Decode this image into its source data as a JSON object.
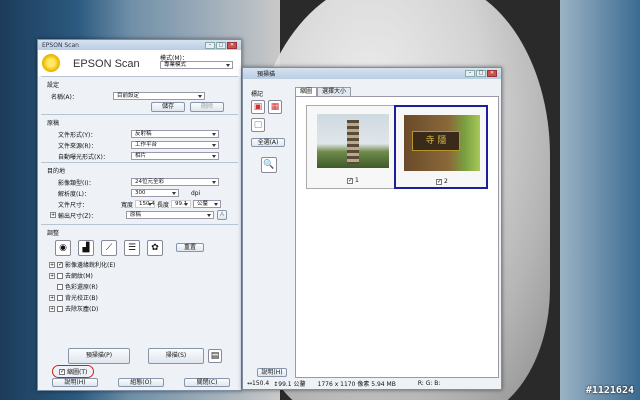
{
  "main": {
    "title": "EPSON Scan",
    "app_name": "EPSON Scan",
    "mode_label": "模式(M)：",
    "mode_value": "專業模式",
    "settings_title": "設定",
    "name_label": "名稱(A)：",
    "name_value": "目前設定",
    "save_btn": "儲存",
    "delete_btn": "刪除",
    "original_title": "原稿",
    "doc_type_label": "文件形式(Y)：",
    "doc_type_value": "反射稿",
    "doc_source_label": "文件來源(R)：",
    "doc_source_value": "工作平台",
    "auto_exposure_label": "自動曝光形式(X)：",
    "auto_exposure_value": "相片",
    "target_title": "目的地",
    "image_type_label": "影像類型(I)：",
    "image_type_value": "24位元全彩",
    "resolution_label": "解析度(L)：",
    "resolution_value": "300",
    "resolution_unit": "dpi",
    "doc_size_label": "文件尺寸：",
    "width_label": "寬度",
    "width_value": "150.4",
    "height_label": "長度",
    "height_value": "99.1",
    "size_unit": "公釐",
    "output_size_label": "輸出尺寸(Z)：",
    "output_size_value": "原稿",
    "adjust_title": "調整",
    "reset_btn": "重置",
    "options": [
      {
        "label": "影像邊緣銳利化(E)",
        "checked": true,
        "expand": true
      },
      {
        "label": "去網紋(M)",
        "checked": false,
        "expand": true
      },
      {
        "label": "色彩還原(R)",
        "checked": false,
        "expand": false
      },
      {
        "label": "背光校正(B)",
        "checked": false,
        "expand": true
      },
      {
        "label": "去除灰塵(D)",
        "checked": false,
        "expand": true
      }
    ],
    "preview_btn": "預掃描(P)",
    "thumbnail_label": "縮圖(T)",
    "scan_btn": "掃描(S)",
    "help_btn": "說明(H)",
    "config_btn": "組態(O)",
    "close_btn": "關閉(C)"
  },
  "preview": {
    "title": "預掃描",
    "side_label": "標記",
    "all_btn": "全選(A)",
    "tab_thumb": "縮圖",
    "tab_normal": "選擇大小",
    "thumb1_label": "1",
    "thumb2_label": "2",
    "help_btn": "說明(H)",
    "status_width": "150.4",
    "status_height": "99.1 公釐",
    "status_pixels": "1776 x 1170 像素 5.94 MB",
    "status_rgb": "R: G: B:"
  },
  "watermark": "#1121624"
}
